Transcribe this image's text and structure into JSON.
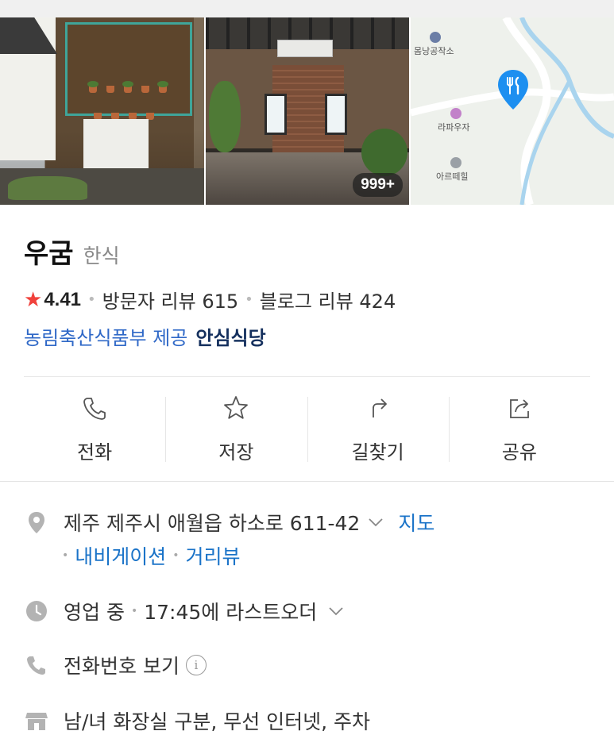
{
  "gallery": {
    "photo_count_badge": "999+"
  },
  "map": {
    "labels": [
      "몸낭공작소",
      "라파우자",
      "아르떼힐"
    ],
    "pin_icon": "restaurant-pin-icon"
  },
  "place": {
    "name": "우굼",
    "category": "한식",
    "rating": "4.41",
    "visitor_reviews": "방문자 리뷰 615",
    "blog_reviews": "블로그 리뷰 424",
    "cert_provider": "농림축산식품부 제공",
    "cert_mark": "안심식당"
  },
  "actions": [
    {
      "label": "전화",
      "icon": "phone-icon"
    },
    {
      "label": "저장",
      "icon": "star-icon"
    },
    {
      "label": "길찾기",
      "icon": "directions-icon"
    },
    {
      "label": "공유",
      "icon": "share-icon"
    }
  ],
  "info": {
    "address": "제주 제주시 애월읍 하소로 611-42",
    "map_link": "지도",
    "navigation_link": "내비게이션",
    "streetview_link": "거리뷰",
    "hours_status": "영업 중",
    "hours_detail": "17:45에 라스트오더",
    "phone": "전화번호 보기",
    "amenities": "남/녀 화장실 구분, 무선 인터넷, 주차"
  },
  "colors": {
    "accent_blue": "#1a73c8",
    "star_red": "#f0413b",
    "pin_blue": "#1d8ff0"
  }
}
